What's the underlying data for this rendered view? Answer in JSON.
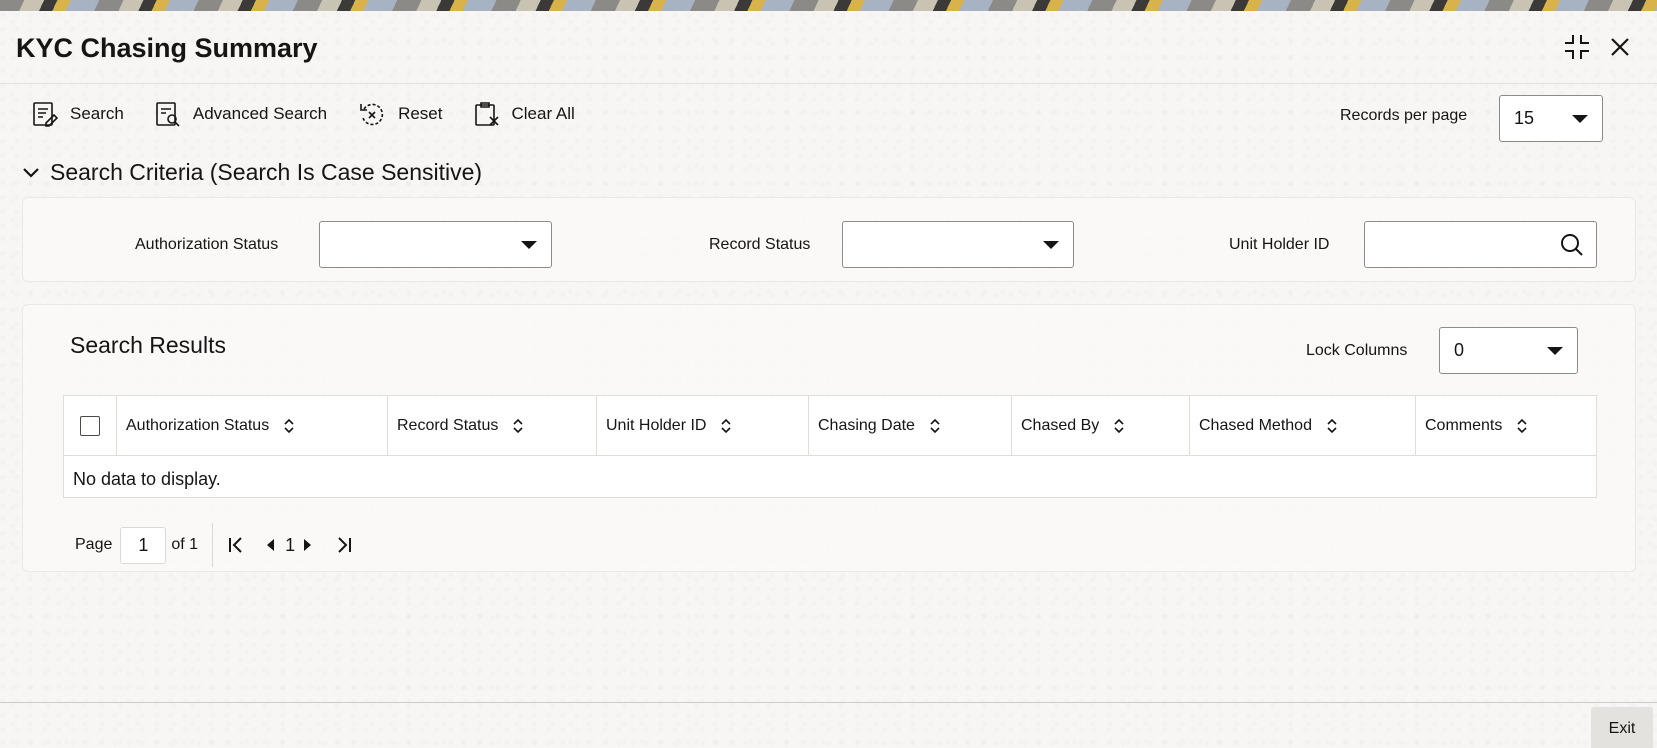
{
  "window": {
    "title": "KYC Chasing Summary"
  },
  "toolbar": {
    "search_label": "Search",
    "advanced_search_label": "Advanced Search",
    "reset_label": "Reset",
    "clear_all_label": "Clear All",
    "records_per_page_label": "Records per page",
    "records_per_page_value": "15"
  },
  "criteria": {
    "heading": "Search Criteria (Search Is Case Sensitive)",
    "authorization_status_label": "Authorization Status",
    "authorization_status_value": "",
    "record_status_label": "Record Status",
    "record_status_value": "",
    "unit_holder_id_label": "Unit Holder ID",
    "unit_holder_id_value": ""
  },
  "results": {
    "title": "Search Results",
    "lock_columns_label": "Lock Columns",
    "lock_columns_value": "0",
    "columns": [
      "Authorization Status",
      "Record Status",
      "Unit Holder ID",
      "Chasing Date",
      "Chased By",
      "Chased Method",
      "Comments"
    ],
    "empty_message": "No data to display."
  },
  "pagination": {
    "page_label": "Page",
    "current_page": "1",
    "of_label": "of 1",
    "page_number": "1"
  },
  "footer": {
    "exit_label": "Exit"
  },
  "icons": {
    "maximize": "compress-icon",
    "close": "close-icon",
    "search_tool": "search-form-icon",
    "advanced_search": "advanced-search-icon",
    "reset": "reset-icon",
    "clear_all": "clear-all-icon",
    "collapse": "chevron-down-icon",
    "lookup": "search-icon",
    "sort": "sort-icon"
  }
}
